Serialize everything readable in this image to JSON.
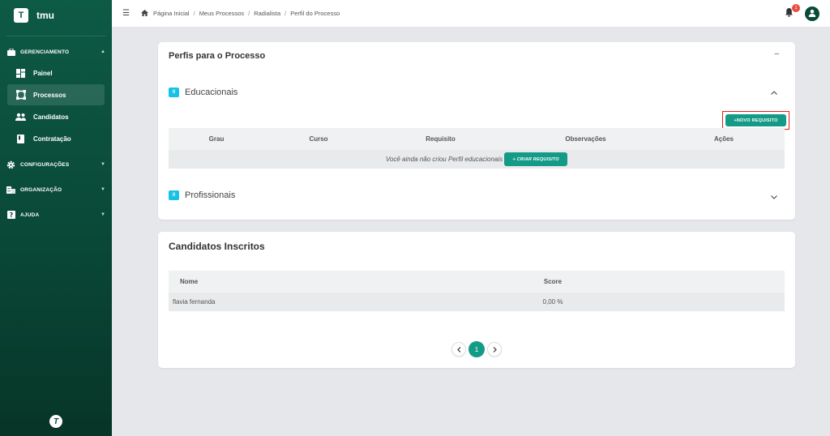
{
  "brand": {
    "logo_letter": "T",
    "name": "tmu",
    "footer_logo": "T"
  },
  "sidebar": {
    "groups": [
      {
        "label": "GERENCIAMENTO",
        "icon": "briefcase-icon"
      },
      {
        "label": "CONFIGURAÇÕES",
        "icon": "gear-icon"
      },
      {
        "label": "ORGANIZAÇÃO",
        "icon": "building-icon"
      },
      {
        "label": "AJUDA",
        "icon": "help-icon"
      }
    ],
    "items": [
      {
        "label": "Painel",
        "icon": "dashboard-icon"
      },
      {
        "label": "Processos",
        "icon": "process-icon"
      },
      {
        "label": "Candidatos",
        "icon": "people-icon"
      },
      {
        "label": "Contratação",
        "icon": "book-icon"
      }
    ]
  },
  "breadcrumb": [
    "Página Inicial",
    "Meus Processos",
    "Radialista",
    "Perfil do Processo"
  ],
  "notifications": {
    "count": "1"
  },
  "profiles_card": {
    "title": "Perfis para o Processo",
    "educational": {
      "count": "0",
      "label": "Educacionais",
      "new_button": "+NOVO REQUISITO",
      "columns": [
        "Grau",
        "Curso",
        "Requisito",
        "Observações",
        "Ações"
      ],
      "empty_text": "Você ainda não criou Perfil educacionais",
      "create_button": "+ CRIAR REQUISITO"
    },
    "professional": {
      "count": "0",
      "label": "Profissionais"
    }
  },
  "candidates_card": {
    "title": "Candidatos Inscritos",
    "columns": [
      "Nome",
      "Score"
    ],
    "rows": [
      {
        "name": "flavia fernanda",
        "score": "0,00 %"
      }
    ],
    "pagination": {
      "current": "1"
    }
  },
  "colors": {
    "sidebar": "#0d5a45",
    "accent": "#149b87",
    "badge": "#17c1e8",
    "highlight": "#e01e1e"
  }
}
